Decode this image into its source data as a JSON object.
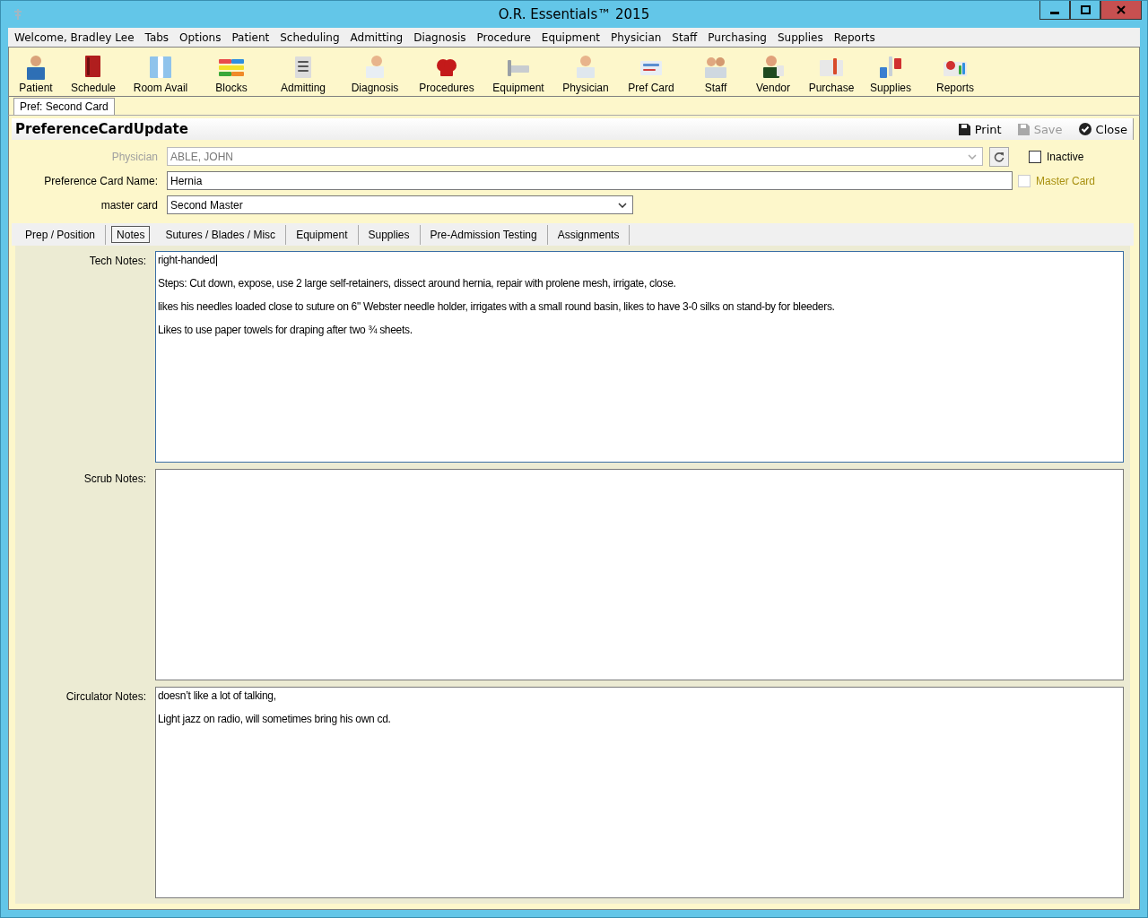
{
  "window": {
    "title": "O.R. Essentials™ 2015"
  },
  "menu": [
    "Welcome, Bradley  Lee",
    "Tabs",
    "Options",
    "Patient",
    "Scheduling",
    "Admitting",
    "Diagnosis",
    "Procedure",
    "Equipment",
    "Physician",
    "Staff",
    "Purchasing",
    "Supplies",
    "Reports"
  ],
  "toolbar": [
    "Patient",
    "Schedule",
    "Room Avail",
    "Blocks",
    "Admitting",
    "Diagnosis",
    "Procedures",
    "Equipment",
    "Physician",
    "Pref Card",
    "Staff",
    "Vendor",
    "Purchase",
    "Supplies",
    "Reports"
  ],
  "document_tabs": [
    {
      "label": "Pref: Second Card",
      "selected": true
    }
  ],
  "form": {
    "title": "PreferenceCardUpdate",
    "actions": [
      {
        "label": "Print",
        "kind": "print",
        "disabled": false
      },
      {
        "label": "Save",
        "kind": "save",
        "disabled": true
      },
      {
        "label": "Close",
        "kind": "close",
        "disabled": false
      }
    ],
    "physician": {
      "label": "Physician",
      "value": "ABLE, JOHN",
      "disabled": true
    },
    "inactive": {
      "label": "Inactive",
      "checked": false
    },
    "card_name": {
      "label": "Preference Card Name:",
      "value": "Hernia"
    },
    "master_card_check": {
      "label": "Master Card",
      "checked": false,
      "disabled": true
    },
    "master_card": {
      "label": "master card",
      "value": "Second Master"
    }
  },
  "tabs": [
    {
      "label": "Prep / Position",
      "selected": false
    },
    {
      "label": "Notes",
      "selected": true
    },
    {
      "label": "Sutures / Blades / Misc",
      "selected": false
    },
    {
      "label": "Equipment",
      "selected": false
    },
    {
      "label": "Supplies",
      "selected": false
    },
    {
      "label": "Pre-Admission Testing",
      "selected": false
    },
    {
      "label": "Assignments",
      "selected": false
    }
  ],
  "notes": [
    {
      "label": "Tech Notes:",
      "focused": true,
      "paragraphs": [
        "right-handed",
        "Steps: Cut down, expose, use 2 large self-retainers, dissect around hernia, repair with prolene mesh, irrigate, close.",
        "likes his needles loaded close to suture on 6\" Webster needle holder, irrigates with a small round basin, likes to have 3-0 silks on stand-by for bleeders.",
        "Likes to use paper towels for draping after two ¾ sheets."
      ]
    },
    {
      "label": "Scrub Notes:",
      "focused": false
    },
    {
      "label": "Circulator Notes:",
      "focused": false,
      "paragraphs": [
        "doesn’t like a lot of talking,",
        "Light jazz on radio, will sometimes bring his own cd."
      ]
    }
  ]
}
